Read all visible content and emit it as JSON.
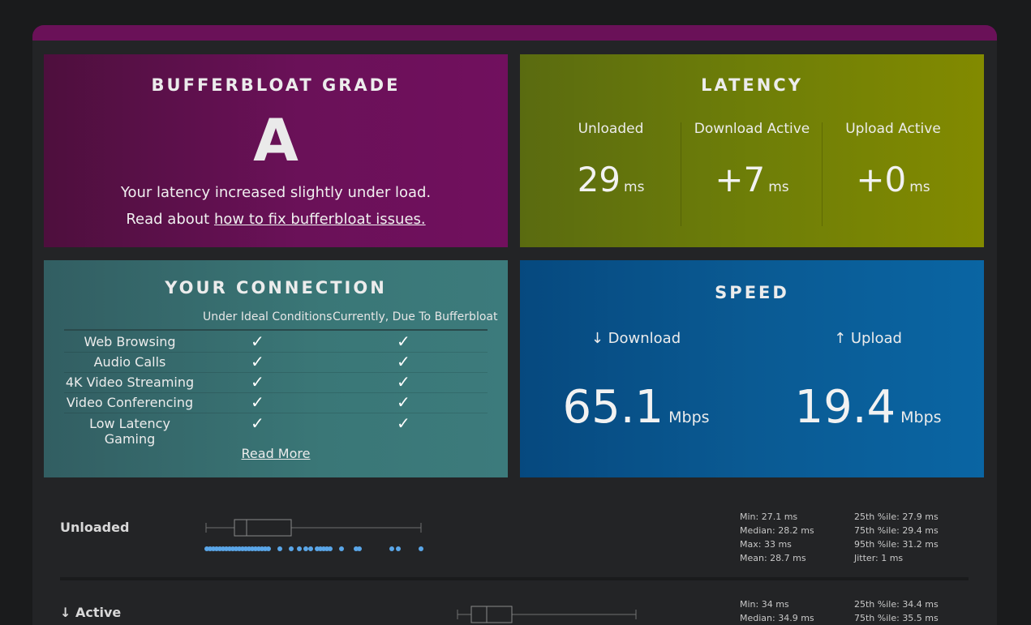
{
  "grade": {
    "title": "BUFFERBLOAT GRADE",
    "letter": "A",
    "description": "Your latency increased slightly under load.",
    "read_prefix": "Read about ",
    "read_link": "how to fix bufferbloat issues."
  },
  "latency": {
    "title": "LATENCY",
    "columns": [
      {
        "label": "Unloaded",
        "value": "29",
        "unit": "ms"
      },
      {
        "label": "Download Active",
        "value": "+7",
        "unit": "ms"
      },
      {
        "label": "Upload Active",
        "value": "+0",
        "unit": "ms"
      }
    ]
  },
  "connection": {
    "title": "YOUR CONNECTION",
    "headers": [
      "Under Ideal Conditions",
      "Currently, Due To Bufferbloat"
    ],
    "rows": [
      {
        "name": "Web Browsing",
        "ideal": "✓",
        "current": "✓"
      },
      {
        "name": "Audio Calls",
        "ideal": "✓",
        "current": "✓"
      },
      {
        "name": "4K Video Streaming",
        "ideal": "✓",
        "current": "✓"
      },
      {
        "name": "Video Conferencing",
        "ideal": "✓",
        "current": "✓"
      },
      {
        "name": "Low Latency Gaming",
        "ideal": "✓",
        "current": "✓"
      }
    ],
    "read_more": "Read More"
  },
  "speed": {
    "title": "SPEED",
    "download": {
      "label": "↓ Download",
      "value": "65.1",
      "unit": "Mbps"
    },
    "upload": {
      "label": "↑ Upload",
      "value": "19.4",
      "unit": "Mbps"
    }
  },
  "stats": {
    "unloaded": {
      "label": "Unloaded",
      "left": [
        "Min: 27.1 ms",
        "Median: 28.2 ms",
        "Max: 33 ms",
        "Mean: 28.7 ms"
      ],
      "right": [
        "25th %ile: 27.9 ms",
        "75th %ile: 29.4 ms",
        "95th %ile: 31.2 ms",
        "Jitter: 1 ms"
      ]
    },
    "active": {
      "label": "↓ Active",
      "left": [
        "Min: 34 ms",
        "Median: 34.9 ms"
      ],
      "right": [
        "25th %ile: 34.4 ms",
        "75th %ile: 35.5 ms"
      ]
    }
  },
  "colors": {
    "grade_bg": "#6a1158",
    "latency_bg": "#6e7e08",
    "connection_bg": "#3a7777",
    "speed_bg": "#0a5a93",
    "dot": "#5aa6e8"
  }
}
